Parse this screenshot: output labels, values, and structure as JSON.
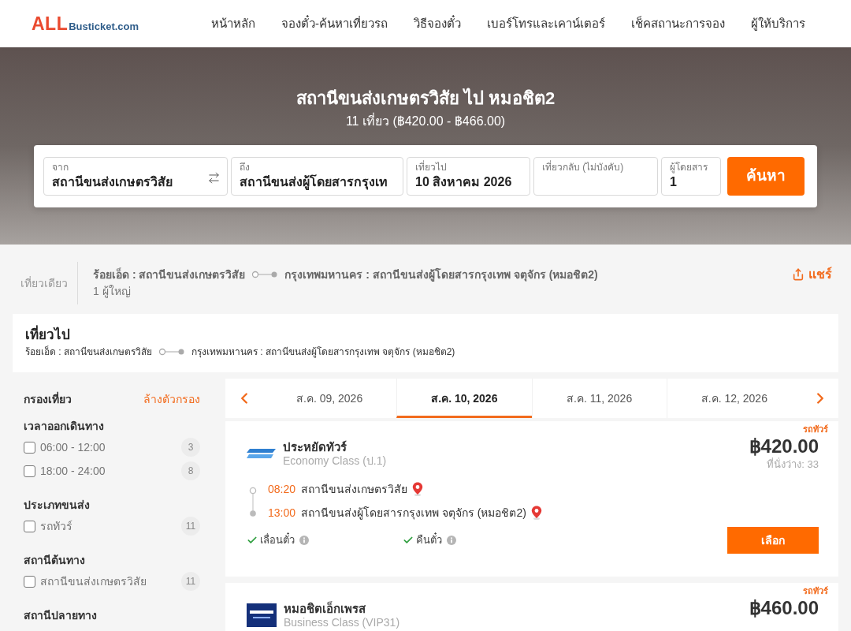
{
  "header": {
    "logo": {
      "part_1": "ALL",
      "part_2": "Busticket.com"
    },
    "nav": [
      "หน้าหลัก",
      "จองตั๋ว-ค้นหาเที่ยวรถ",
      "วิธีจองตั๋ว",
      "เบอร์โทรและเคาน์เตอร์",
      "เช็คสถานะการจอง",
      "ผู้ให้บริการ"
    ]
  },
  "hero": {
    "title": "สถานีขนส่งเกษตรวิสัย ไป หมอชิต2",
    "subtitle": "11 เที่ยว (฿420.00 - ฿466.00)"
  },
  "search_form": {
    "fields": [
      {
        "kind": "origin",
        "label": "จาก",
        "value": "สถานีขนส่งเกษตรวิสัย"
      },
      {
        "kind": "destination",
        "label": "ถึง",
        "value": "สถานีขนส่งผู้โดยสารกรุงเท"
      },
      {
        "kind": "date",
        "label": "เที่ยวไป",
        "value": "10 สิงหาคม 2026"
      },
      {
        "kind": "return_date",
        "label": "เที่ยวกลับ (ไม่บังคับ)"
      },
      {
        "kind": "passengers",
        "label": "ผู้โดยสาร",
        "value": "1"
      }
    ],
    "button": "ค้นหา"
  },
  "trip_summary": {
    "trip_type": "เที่ยวเดียว",
    "origin": "ร้อยเอ็ด : สถานีขนส่งเกษตรวิสัย",
    "destination": "กรุงเทพมหานคร : สถานีขนส่งผู้โดยสารกรุงเทพ จตุจักร (หมอชิต2)",
    "passengers": "1 ผู้ใหญ่",
    "share": "แชร์"
  },
  "outbound": {
    "title": "เที่ยวไป",
    "origin": "ร้อยเอ็ด : สถานีขนส่งเกษตรวิสัย",
    "destination": "กรุงเทพมหานคร : สถานีขนส่งผู้โดยสารกรุงเทพ จตุจักร (หมอชิต2)"
  },
  "filters": {
    "title": "กรองเที่ยว",
    "clear": "ล้างตัวกรอง",
    "groups": [
      {
        "title": "เวลาออกเดินทาง",
        "options": [
          {
            "label": "06:00 - 12:00",
            "count": "3",
            "checked": false
          },
          {
            "label": "18:00 - 24:00",
            "count": "8",
            "checked": false
          }
        ]
      },
      {
        "title": "ประเภทขนส่ง",
        "options": [
          {
            "label": "รถทัวร์",
            "count": "11",
            "checked": false
          }
        ]
      },
      {
        "title": "สถานีต้นทาง",
        "options": [
          {
            "label": "สถานีขนส่งเกษตรวิสัย",
            "count": "11",
            "checked": false
          }
        ]
      },
      {
        "title": "สถานีปลายทาง"
      }
    ]
  },
  "date_tabs": [
    {
      "label": "ส.ค. 09, 2026",
      "selected": false
    },
    {
      "label": "ส.ค. 10, 2026",
      "selected": true
    },
    {
      "label": "ส.ค. 11, 2026",
      "selected": false
    },
    {
      "label": "ส.ค. 12, 2026",
      "selected": false
    }
  ],
  "trips": [
    {
      "kind": "stripes",
      "tag": "รถทัวร์",
      "operator": "ประหยัดทัวร์",
      "class": "Economy Class (ป.1)",
      "price": "฿420.00",
      "seats": "ที่นั่งว่าง: 33",
      "stops": [
        {
          "time": "08:20",
          "station": "สถานีขนส่งเกษตรวิสัย"
        },
        {
          "time": "13:00",
          "station": "สถานีขนส่งผู้โดยสารกรุงเทพ จตุจักร (หมอชิต2)"
        }
      ],
      "features": [
        {
          "label": "เลื่อนตั๋ว",
          "available": true
        },
        {
          "label": "คืนตั๋ว",
          "available": true
        }
      ],
      "button": "เลือก"
    },
    {
      "kind": "badge",
      "tag": "รถทัวร์",
      "operator": "หมอชิตเอ็กเพรส",
      "class": "Business Class (VIP31)",
      "price": "฿460.00"
    }
  ]
}
